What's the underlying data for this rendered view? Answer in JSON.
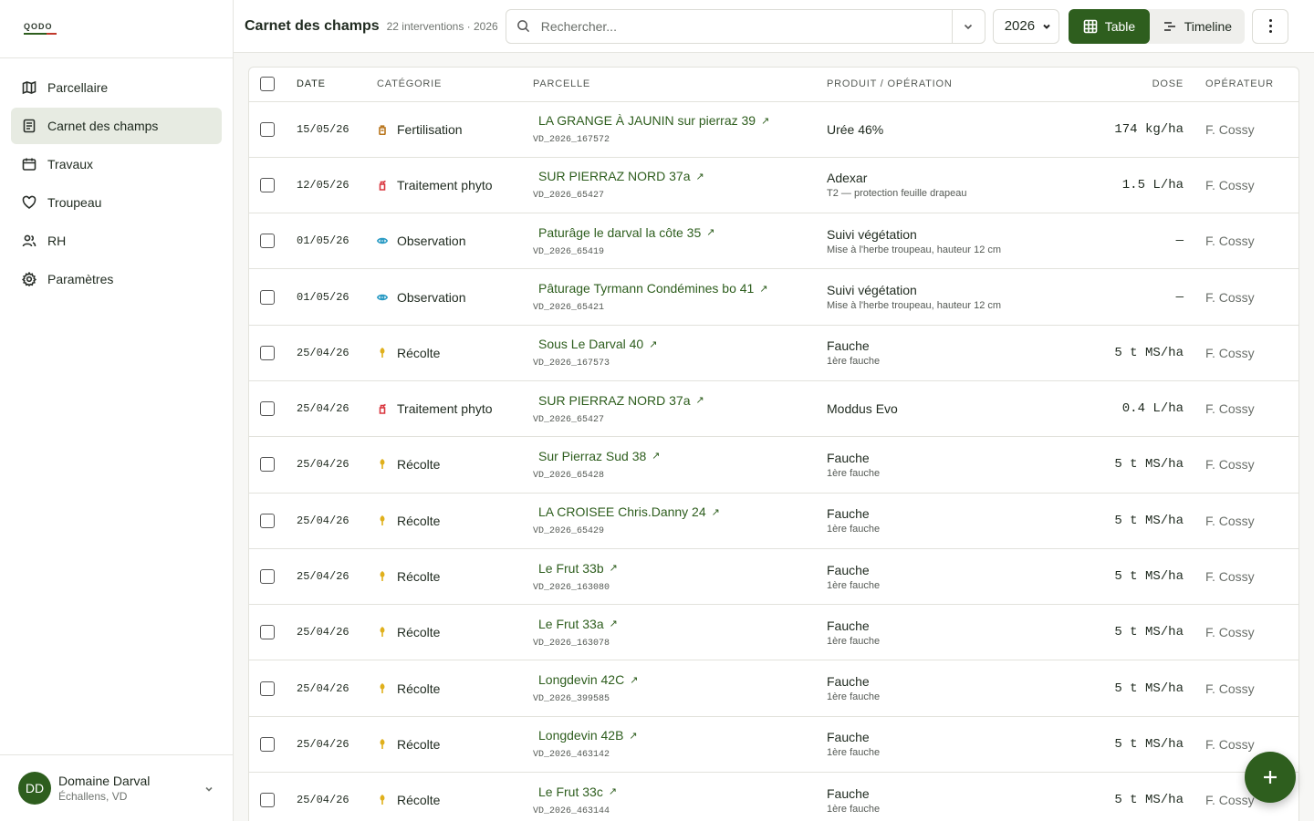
{
  "brand": {
    "logo_text": "QODO"
  },
  "sidebar": {
    "items": [
      {
        "label": "Parcellaire",
        "icon": "map-icon",
        "active": false
      },
      {
        "label": "Carnet des champs",
        "icon": "notebook-icon",
        "active": true
      },
      {
        "label": "Travaux",
        "icon": "calendar-icon",
        "active": false
      },
      {
        "label": "Troupeau",
        "icon": "heart-icon",
        "active": false
      },
      {
        "label": "RH",
        "icon": "users-icon",
        "active": false
      },
      {
        "label": "Paramètres",
        "icon": "gear-icon",
        "active": false
      }
    ]
  },
  "account": {
    "initials": "DD",
    "name": "Domaine Darval",
    "location": "Échallens, VD"
  },
  "header": {
    "title": "Carnet des champs",
    "subtitle": "22 interventions · 2026",
    "search_placeholder": "Rechercher...",
    "year": "2026",
    "view_table": "Table",
    "view_timeline": "Timeline"
  },
  "table": {
    "columns": [
      "DATE",
      "CATÉGORIE",
      "PARCELLE",
      "PRODUIT / OPÉRATION",
      "DOSE",
      "OPÉRATEUR"
    ],
    "rows": [
      {
        "date": "15/05/26",
        "category": "Fertilisation",
        "cat_icon": "fertilizer-icon",
        "parcel": "LA GRANGE À JAUNIN sur pierraz 39",
        "parcel_id": "VD_2026_167572",
        "product": "Urée 46%",
        "note": "",
        "dose": "174 kg/ha",
        "operator": "F. Cossy"
      },
      {
        "date": "12/05/26",
        "category": "Traitement phyto",
        "cat_icon": "spray-icon",
        "parcel": "SUR PIERRAZ NORD 37a",
        "parcel_id": "VD_2026_65427",
        "product": "Adexar",
        "note": "T2 — protection feuille drapeau",
        "dose": "1.5 L/ha",
        "operator": "F. Cossy"
      },
      {
        "date": "01/05/26",
        "category": "Observation",
        "cat_icon": "eye-icon",
        "parcel": "Paturâge le darval la côte 35",
        "parcel_id": "VD_2026_65419",
        "product": "Suivi végétation",
        "note": "Mise à l'herbe troupeau, hauteur 12 cm",
        "dose": "—",
        "operator": "F. Cossy"
      },
      {
        "date": "01/05/26",
        "category": "Observation",
        "cat_icon": "eye-icon",
        "parcel": "Pâturage Tyrmann Condémines bo 41",
        "parcel_id": "VD_2026_65421",
        "product": "Suivi végétation",
        "note": "Mise à l'herbe troupeau, hauteur 12 cm",
        "dose": "—",
        "operator": "F. Cossy"
      },
      {
        "date": "25/04/26",
        "category": "Récolte",
        "cat_icon": "harvest-icon",
        "parcel": "Sous Le Darval 40",
        "parcel_id": "VD_2026_167573",
        "product": "Fauche",
        "note": "1ère fauche",
        "dose": "5 t MS/ha",
        "operator": "F. Cossy"
      },
      {
        "date": "25/04/26",
        "category": "Traitement phyto",
        "cat_icon": "spray-icon",
        "parcel": "SUR PIERRAZ NORD 37a",
        "parcel_id": "VD_2026_65427",
        "product": "Moddus Evo",
        "note": "",
        "dose": "0.4 L/ha",
        "operator": "F. Cossy"
      },
      {
        "date": "25/04/26",
        "category": "Récolte",
        "cat_icon": "harvest-icon",
        "parcel": "Sur Pierraz Sud 38",
        "parcel_id": "VD_2026_65428",
        "product": "Fauche",
        "note": "1ère fauche",
        "dose": "5 t MS/ha",
        "operator": "F. Cossy"
      },
      {
        "date": "25/04/26",
        "category": "Récolte",
        "cat_icon": "harvest-icon",
        "parcel": "LA CROISEE Chris.Danny 24",
        "parcel_id": "VD_2026_65429",
        "product": "Fauche",
        "note": "1ère fauche",
        "dose": "5 t MS/ha",
        "operator": "F. Cossy"
      },
      {
        "date": "25/04/26",
        "category": "Récolte",
        "cat_icon": "harvest-icon",
        "parcel": "Le Frut 33b",
        "parcel_id": "VD_2026_163080",
        "product": "Fauche",
        "note": "1ère fauche",
        "dose": "5 t MS/ha",
        "operator": "F. Cossy"
      },
      {
        "date": "25/04/26",
        "category": "Récolte",
        "cat_icon": "harvest-icon",
        "parcel": "Le Frut 33a",
        "parcel_id": "VD_2026_163078",
        "product": "Fauche",
        "note": "1ère fauche",
        "dose": "5 t MS/ha",
        "operator": "F. Cossy"
      },
      {
        "date": "25/04/26",
        "category": "Récolte",
        "cat_icon": "harvest-icon",
        "parcel": "Longdevin 42C",
        "parcel_id": "VD_2026_399585",
        "product": "Fauche",
        "note": "1ère fauche",
        "dose": "5 t MS/ha",
        "operator": "F. Cossy"
      },
      {
        "date": "25/04/26",
        "category": "Récolte",
        "cat_icon": "harvest-icon",
        "parcel": "Longdevin 42B",
        "parcel_id": "VD_2026_463142",
        "product": "Fauche",
        "note": "1ère fauche",
        "dose": "5 t MS/ha",
        "operator": "F. Cossy"
      },
      {
        "date": "25/04/26",
        "category": "Récolte",
        "cat_icon": "harvest-icon",
        "parcel": "Le Frut 33c",
        "parcel_id": "VD_2026_463144",
        "product": "Fauche",
        "note": "1ère fauche",
        "dose": "5 t MS/ha",
        "operator": "F. Cossy"
      }
    ]
  },
  "colors": {
    "accent": "#2e5e1e",
    "fertilisation": "#b8741a",
    "phyto": "#d9363e",
    "observation": "#2a9bc4",
    "recolte": "#e0b01c"
  }
}
